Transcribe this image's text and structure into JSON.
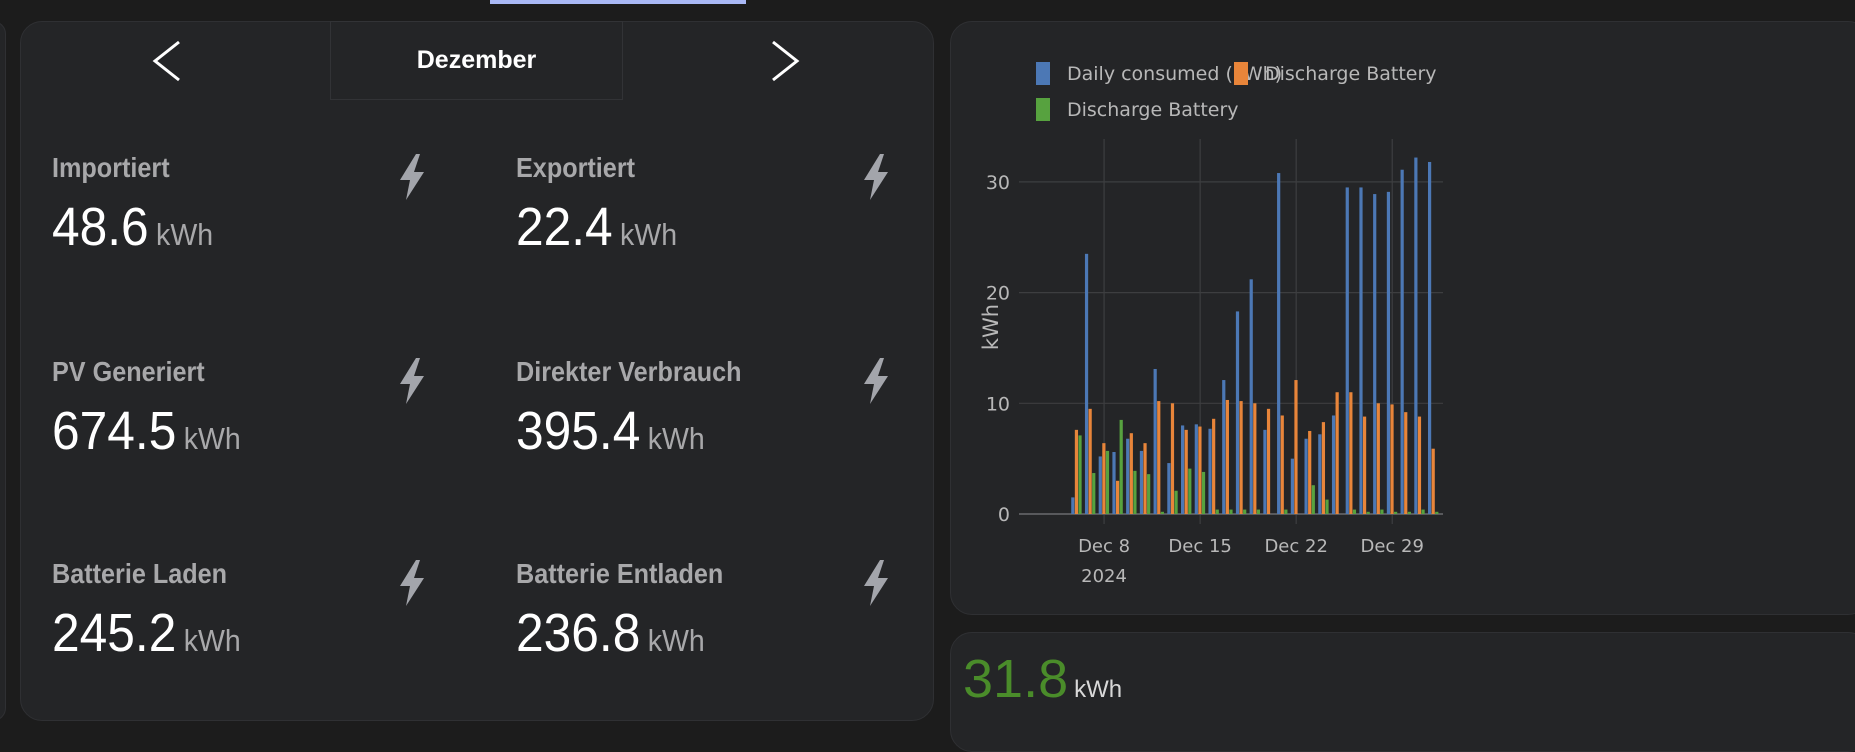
{
  "month_nav": {
    "prev_label": "<",
    "month": "Dezember",
    "next_label": ">"
  },
  "stats": [
    {
      "label": "Importiert",
      "value": "48.6",
      "unit": "kWh",
      "icon": "lightning-bolt-icon"
    },
    {
      "label": "Exportiert",
      "value": "22.4",
      "unit": "kWh",
      "icon": "lightning-bolt-icon"
    },
    {
      "label": "PV Generiert",
      "value": "674.5",
      "unit": "kWh",
      "icon": "lightning-bolt-icon"
    },
    {
      "label": "Direkter Verbrauch",
      "value": "395.4",
      "unit": "kWh",
      "icon": "lightning-bolt-icon"
    },
    {
      "label": "Batterie Laden",
      "value": "245.2",
      "unit": "kWh",
      "icon": "lightning-bolt-icon"
    },
    {
      "label": "Batterie Entladen",
      "value": "236.8",
      "unit": "kWh",
      "icon": "lightning-bolt-icon"
    }
  ],
  "bottom_card": {
    "value": "31.8",
    "unit": "kWh",
    "color": "#4a8c2a"
  },
  "chart_data": {
    "type": "bar",
    "ylabel": "kWh",
    "ylim": [
      0,
      34
    ],
    "yticks": [
      0,
      10,
      20,
      30
    ],
    "x_unit": "day of December 2024 (32 = Jan 1)",
    "xlim": [
      1.8,
      32.7
    ],
    "xticks": [
      {
        "day": 8,
        "label": "Dec 8",
        "sublabel": "2024"
      },
      {
        "day": 15,
        "label": "Dec 15"
      },
      {
        "day": 22,
        "label": "Dec 22"
      },
      {
        "day": 29,
        "label": "Dec 29"
      }
    ],
    "grid": true,
    "legend_position": "top",
    "x": [
      6,
      7,
      8,
      9,
      10,
      11,
      12,
      13,
      14,
      15,
      16,
      17,
      18,
      19,
      20,
      21,
      22,
      23,
      24,
      25,
      26,
      27,
      28,
      29,
      30,
      31,
      32
    ],
    "series": [
      {
        "name": "Daily consumed (kWh)",
        "color": "#4c78b5",
        "values": [
          1.5,
          23.5,
          5.2,
          5.6,
          6.8,
          5.7,
          13.1,
          4.6,
          8.0,
          8.1,
          7.7,
          12.1,
          18.3,
          21.2,
          7.6,
          30.8,
          5.0,
          6.8,
          7.2,
          8.9,
          29.5,
          29.5,
          28.9,
          29.1,
          31.1,
          32.2,
          31.8
        ]
      },
      {
        "name": "Discharge Battery",
        "color": "#e8853a",
        "values": [
          7.6,
          9.5,
          6.4,
          3.0,
          7.3,
          6.4,
          10.2,
          10.0,
          7.6,
          7.9,
          8.6,
          10.3,
          10.2,
          10.0,
          9.5,
          8.9,
          12.1,
          7.5,
          8.3,
          11.0,
          11.0,
          8.8,
          10.0,
          9.9,
          9.2,
          8.8,
          5.9
        ]
      },
      {
        "name": "Discharge Battery",
        "color": "#57a23f",
        "values": [
          7.1,
          3.7,
          5.7,
          8.5,
          3.9,
          3.6,
          0.2,
          2.1,
          4.1,
          3.8,
          0.4,
          0.4,
          0.4,
          0.4,
          0,
          0.4,
          0,
          2.6,
          1.3,
          0,
          0.4,
          0.2,
          0.4,
          0.2,
          0.2,
          0.4,
          0.2
        ]
      }
    ]
  }
}
